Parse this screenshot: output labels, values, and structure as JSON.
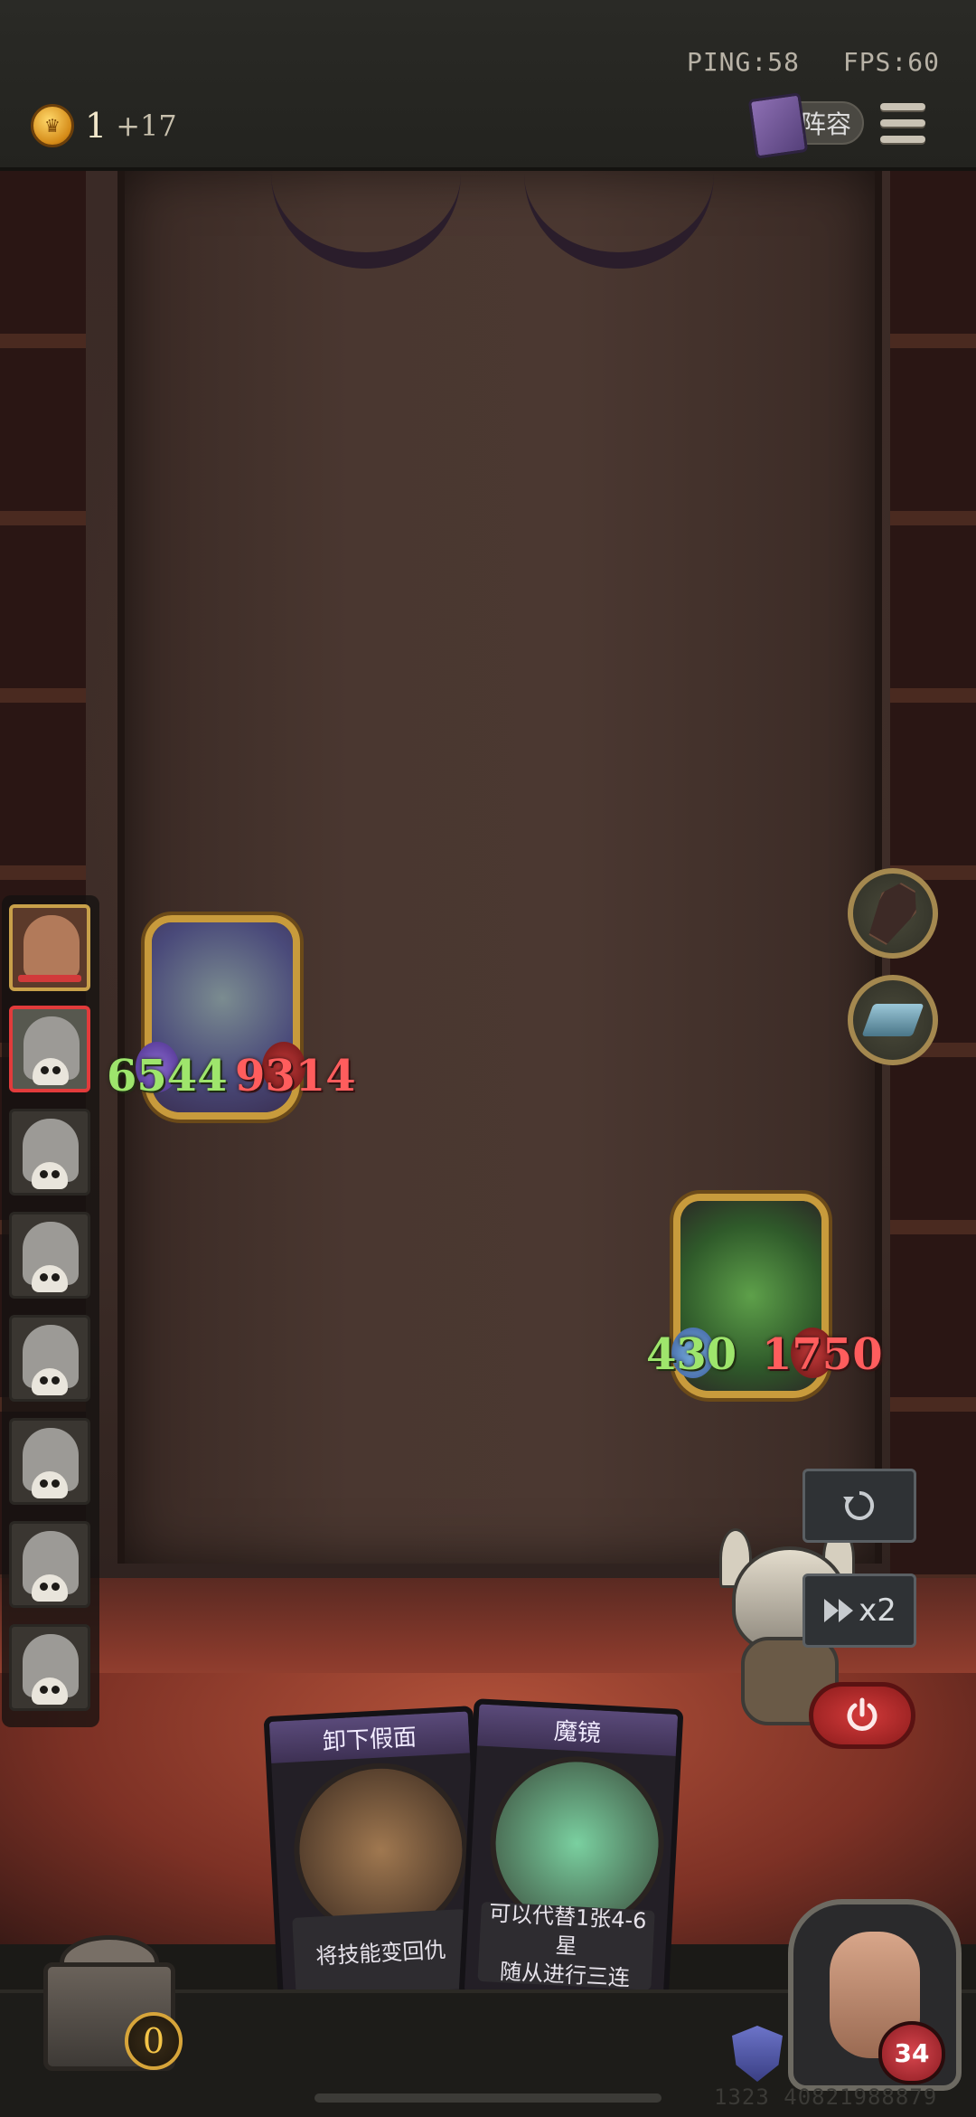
{
  "header": {
    "ping": "PING:58",
    "fps": "FPS:60",
    "gold": "1",
    "gold_income": "+17",
    "lineup_label": "阵容"
  },
  "icons": {
    "coin": "crown-coin-icon",
    "lineup": "book-icon",
    "menu": "menu-icon",
    "sell": "coffin-icon",
    "freeze": "ice-block-icon",
    "refresh": "refresh-icon",
    "speed": "fast-forward-icon",
    "power": "power-icon",
    "shield": "shield-icon",
    "hp": "heart-icon"
  },
  "enemy_unit": {
    "attack": "6544",
    "health": "9314"
  },
  "player_unit": {
    "attack": "430",
    "health": "1750"
  },
  "controls": {
    "speed_label": "x2"
  },
  "cards": [
    {
      "title": "卸下假面",
      "description": "将技能变回仇"
    },
    {
      "title": "魔镜",
      "description_line1": "可以代替1张4-6星",
      "description_line2": "随从进行三连",
      "stars": "★★★★★★"
    }
  ],
  "chest": {
    "count": "0"
  },
  "hero": {
    "health": "34"
  },
  "player_id": "1323 40821988879",
  "colors": {
    "attack": "#9ee56c",
    "health": "#ff5d5d",
    "gold_frame": "#c89b3c",
    "danger": "#d33a3a"
  }
}
